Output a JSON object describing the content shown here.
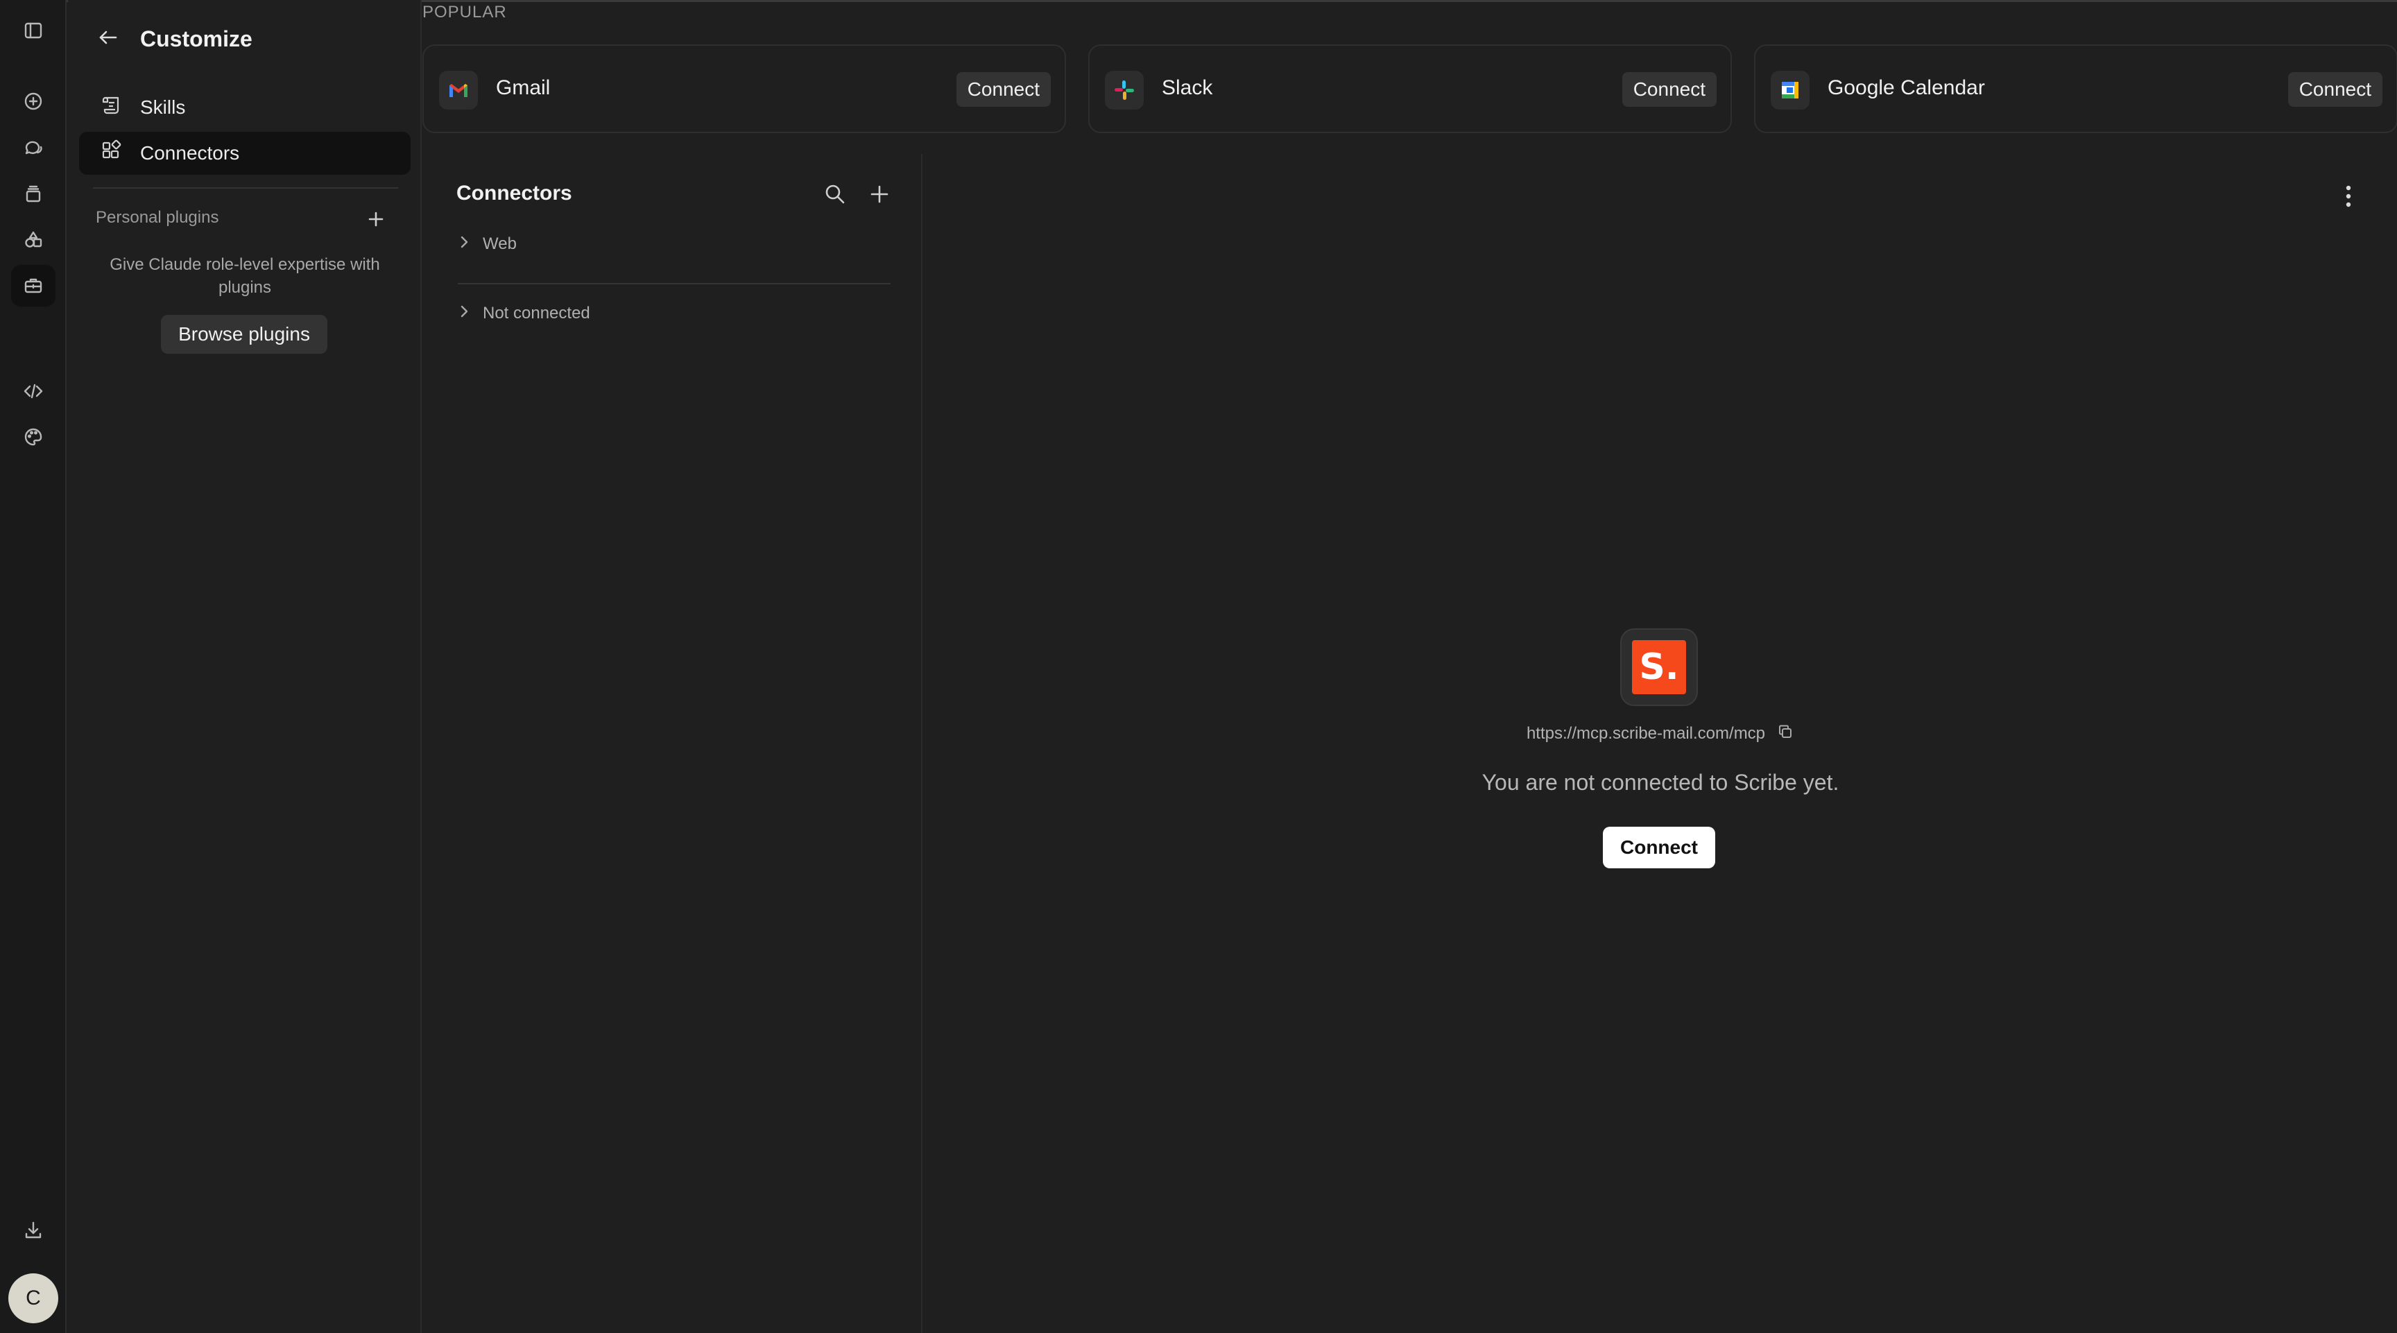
{
  "sidebar": {
    "title": "Customize",
    "nav": [
      {
        "label": "Skills",
        "icon": "skills-scroll-icon"
      },
      {
        "label": "Connectors",
        "icon": "connectors-icon",
        "active": true
      }
    ],
    "personal_plugins_label": "Personal plugins",
    "plugins_description": "Give Claude role-level expertise with plugins",
    "browse_button": "Browse plugins"
  },
  "rail": {
    "icons": [
      "sidebar-toggle-icon",
      "new-chat-icon",
      "chats-icon",
      "projects-icon",
      "artifacts-icon",
      "customize-icon",
      "code-icon",
      "palette-icon",
      "download-icon"
    ],
    "avatar_initial": "C"
  },
  "popular": {
    "label": "POPULAR",
    "cards": [
      {
        "name": "Gmail",
        "button": "Connect",
        "icon": "gmail-icon"
      },
      {
        "name": "Slack",
        "button": "Connect",
        "icon": "slack-icon"
      },
      {
        "name": "Google Calendar",
        "button": "Connect",
        "icon": "google-calendar-icon"
      }
    ]
  },
  "connectors_list": {
    "title": "Connectors",
    "groups": [
      "Web",
      "Not connected"
    ]
  },
  "detail": {
    "logo_text": "S.",
    "logo_color": "#f5491b",
    "url": "https://mcp.scribe-mail.com/mcp",
    "status": "You are not connected to Scribe yet.",
    "connect_button": "Connect"
  }
}
